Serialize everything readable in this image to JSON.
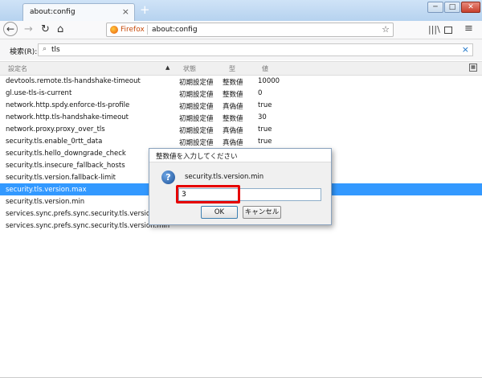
{
  "tab": {
    "title": "about:config",
    "close": "×",
    "newtab": "+"
  },
  "window": {
    "min": "─",
    "max": "□",
    "close": "✕"
  },
  "nav": {
    "back": "←",
    "forward": "→",
    "reload": "↻",
    "home": "⌂",
    "identity": "Firefox",
    "url": "about:config",
    "star": "☆",
    "library": "|||\\",
    "menu": "≡"
  },
  "search": {
    "label": "検索(R):",
    "icon": "⌕",
    "value": "tls",
    "clear": "×"
  },
  "columns": {
    "name": "設定名",
    "sort": "▲",
    "status": "状態",
    "type": "型",
    "value": "値",
    "picker": "▦"
  },
  "rows": [
    {
      "name": "devtools.remote.tls-handshake-timeout",
      "status": "初期設定値",
      "type": "整数値",
      "value": "10000"
    },
    {
      "name": "gl.use-tls-is-current",
      "status": "初期設定値",
      "type": "整数値",
      "value": "0"
    },
    {
      "name": "network.http.spdy.enforce-tls-profile",
      "status": "初期設定値",
      "type": "真偽値",
      "value": "true"
    },
    {
      "name": "network.http.tls-handshake-timeout",
      "status": "初期設定値",
      "type": "整数値",
      "value": "30"
    },
    {
      "name": "network.proxy.proxy_over_tls",
      "status": "初期設定値",
      "type": "真偽値",
      "value": "true"
    },
    {
      "name": "security.tls.enable_0rtt_data",
      "status": "初期設定値",
      "type": "真偽値",
      "value": "true"
    },
    {
      "name": "security.tls.hello_downgrade_check",
      "status": "",
      "type": "",
      "value": ""
    },
    {
      "name": "security.tls.insecure_fallback_hosts",
      "status": "",
      "type": "",
      "value": ""
    },
    {
      "name": "security.tls.version.fallback-limit",
      "status": "",
      "type": "",
      "value": ""
    },
    {
      "name": "security.tls.version.max",
      "status": "",
      "type": "",
      "value": ""
    },
    {
      "name": "security.tls.version.min",
      "status": "",
      "type": "",
      "value": ""
    },
    {
      "name": "services.sync.prefs.sync.security.tls.version.max",
      "status": "",
      "type": "",
      "value": ""
    },
    {
      "name": "services.sync.prefs.sync.security.tls.version.min",
      "status": "",
      "type": "",
      "value": ""
    }
  ],
  "dialog": {
    "title": "整数値を入力してください",
    "icon": "?",
    "message": "security.tls.version.min",
    "input_value": "3",
    "ok": "OK",
    "cancel": "キャンセル"
  },
  "colors": {
    "selection": "#3399ff",
    "highlight": "#e60000",
    "firefox": "#c64b0b"
  }
}
